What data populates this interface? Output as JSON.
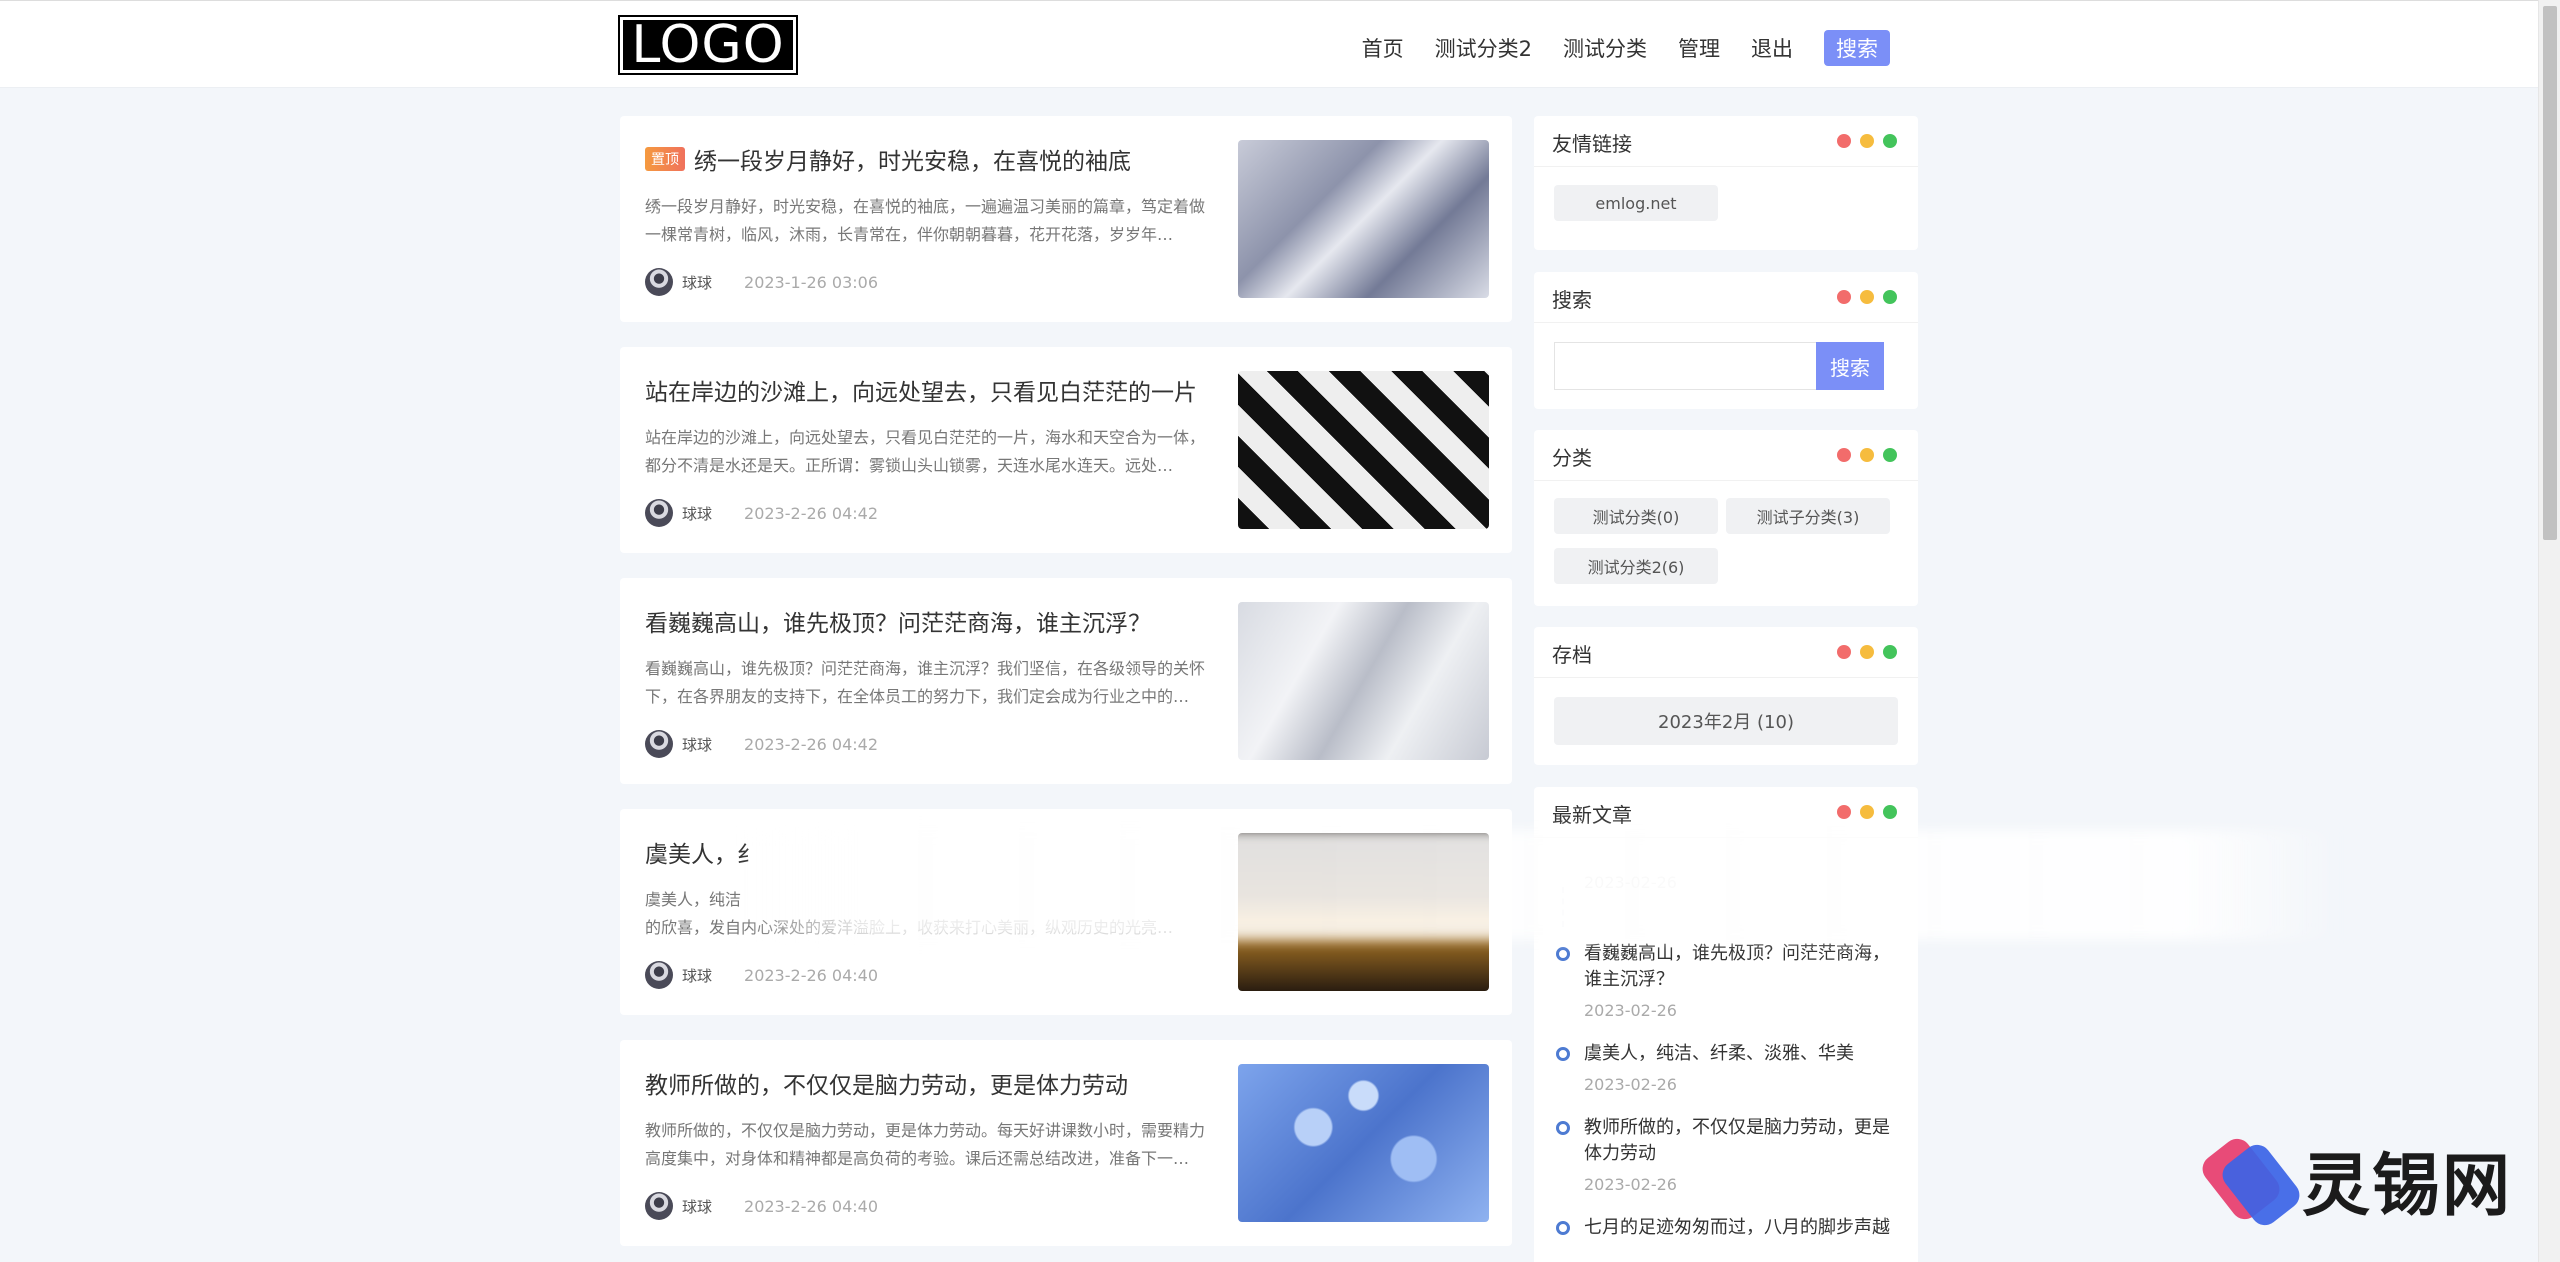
{
  "header": {
    "logo_text": "LOGO",
    "nav": [
      "首页",
      "测试分类2",
      "测试分类",
      "管理",
      "退出"
    ],
    "search_label": "搜索"
  },
  "posts": [
    {
      "badge": "置顶",
      "title": "绣一段岁月静好，时光安稳，在喜悦的袖底",
      "excerpt": "绣一段岁月静好，时光安稳，在喜悦的袖底，一遍遍温习美丽的篇章，笃定着做一棵常青树，临风，沐雨，长青常在，伴你朝朝暮暮，花开花落，岁岁年…",
      "author": "球球",
      "date": "2023-1-26 03:06"
    },
    {
      "title": "站在岸边的沙滩上，向远处望去，只看见白茫茫的一片",
      "excerpt": "站在岸边的沙滩上，向远处望去，只看见白茫茫的一片，海水和天空合为一体，都分不清是水还是天。正所谓：雾锁山头山锁雾，天连水尾水连天。远处…",
      "author": "球球",
      "date": "2023-2-26 04:42"
    },
    {
      "title": "看巍巍高山，谁先极顶？问茫茫商海，谁主沉浮？",
      "excerpt": "看巍巍高山，谁先极顶？问茫茫商海，谁主沉浮？我们坚信，在各级领导的关怀下，在各界朋友的支持下，在全体员工的努力下，我们定会成为行业之中的…",
      "author": "球球",
      "date": "2023-2-26 04:42"
    },
    {
      "title": "虞美人，纟",
      "excerpt": "虞美人，纯洁\n的欣喜，发自内心深处的爱洋溢脸上，收获来打心美丽，纵观历史的光亮…",
      "author": "球球",
      "date": "2023-2-26 04:40"
    },
    {
      "title": "教师所做的，不仅仅是脑力劳动，更是体力劳动",
      "excerpt": "教师所做的，不仅仅是脑力劳动，更是体力劳动。每天好讲课数小时，需要精力高度集中，对身体和精神都是高负荷的考验。课后还需总结改进，准备下一…",
      "author": "球球",
      "date": "2023-2-26 04:40"
    }
  ],
  "sidebar": {
    "links": {
      "title": "友情链接",
      "items": [
        "emlog.net"
      ]
    },
    "search": {
      "title": "搜索",
      "button": "搜索",
      "placeholder": ""
    },
    "categories": {
      "title": "分类",
      "items": [
        "测试分类(0)",
        "测试子分类(3)",
        "测试分类2(6)"
      ]
    },
    "archive": {
      "title": "存档",
      "items": [
        "2023年2月 (10)"
      ]
    },
    "recent": {
      "title": "最新文章",
      "partial_date": "2023-02-26",
      "items": [
        {
          "title": "看巍巍高山，谁先极顶？问茫茫商海，谁主沉浮？",
          "date": "2023-02-26"
        },
        {
          "title": "虞美人，纯洁、纤柔、淡雅、华美",
          "date": "2023-02-26"
        },
        {
          "title": "教师所做的，不仅仅是脑力劳动，更是体力劳动",
          "date": "2023-02-26"
        },
        {
          "title": "七月的足迹匆匆而过，八月的脚步声越",
          "date": ""
        }
      ]
    }
  },
  "watermark": {
    "text": "灵锡网"
  },
  "colors": {
    "accent": "#7b8ff7",
    "timeline": "#4e7bd2",
    "dot_red": "#f26c6b",
    "dot_yellow": "#f6bc3e",
    "dot_green": "#43c45b"
  }
}
